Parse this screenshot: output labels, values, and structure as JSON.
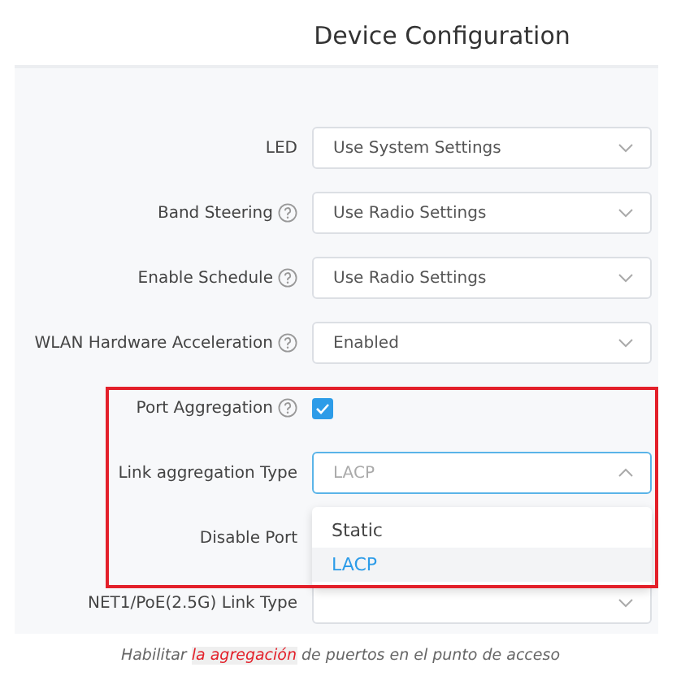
{
  "title": "Device Configuration",
  "rows": [
    {
      "label": "LED",
      "help": false,
      "kind": "select",
      "value": "Use System Settings",
      "open": false
    },
    {
      "label": "Band Steering",
      "help": true,
      "kind": "select",
      "value": "Use Radio Settings",
      "open": false
    },
    {
      "label": "Enable Schedule",
      "help": true,
      "kind": "select",
      "value": "Use Radio Settings",
      "open": false
    },
    {
      "label": "WLAN Hardware Acceleration",
      "help": true,
      "kind": "select",
      "value": "Enabled",
      "open": false
    },
    {
      "label": "Port Aggregation",
      "help": true,
      "kind": "checkbox",
      "checked": true
    },
    {
      "label": "Link aggregation Type",
      "help": false,
      "kind": "select",
      "placeholder": "LACP",
      "open": true,
      "options": [
        {
          "label": "Static",
          "selected": false
        },
        {
          "label": "LACP",
          "selected": true
        }
      ]
    },
    {
      "label": "Disable Port",
      "help": false,
      "kind": "covered"
    },
    {
      "label": "NET1/PoE(2.5G) Link Type",
      "help": false,
      "kind": "select",
      "open": false
    }
  ],
  "caption": [
    {
      "text": "Habilitar ",
      "highlighted": false
    },
    {
      "text": "la agregación",
      "highlighted": true
    },
    {
      "text": " de puertos en el punto de acceso",
      "highlighted": false
    }
  ]
}
